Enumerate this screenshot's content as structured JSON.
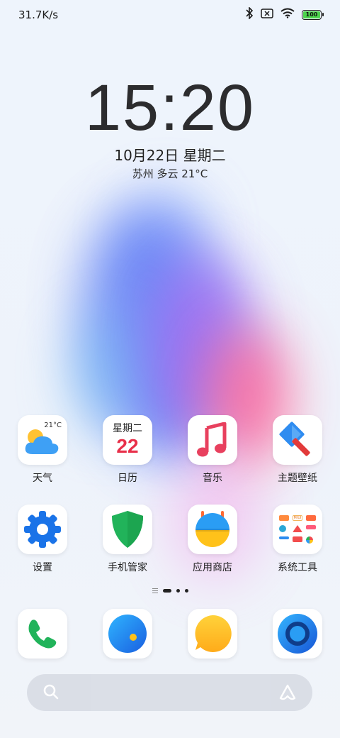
{
  "status_bar": {
    "network_speed": "31.7K/s",
    "battery_level": "100",
    "icons": [
      "bluetooth-icon",
      "no-sim-icon",
      "wifi-icon",
      "battery-icon"
    ]
  },
  "lockscreen_widget": {
    "time": "15:20",
    "date": "10月22日 星期二",
    "weather": "苏州 多云 21°C"
  },
  "home_apps": [
    {
      "label": "天气",
      "icon": "weather-icon",
      "temp": "21°C"
    },
    {
      "label": "日历",
      "icon": "calendar-icon",
      "weekday": "星期二",
      "day": "22"
    },
    {
      "label": "音乐",
      "icon": "music-icon"
    },
    {
      "label": "主题壁纸",
      "icon": "theme-brush-icon"
    },
    {
      "label": "设置",
      "icon": "settings-gear-icon"
    },
    {
      "label": "手机管家",
      "icon": "security-shield-icon"
    },
    {
      "label": "应用商店",
      "icon": "app-store-icon"
    },
    {
      "label": "系统工具",
      "icon": "system-tools-folder-icon",
      "folder_badge": "MIUI"
    }
  ],
  "page_indicator": {
    "pages": 4,
    "active": 1
  },
  "dock": [
    {
      "icon": "phone-icon"
    },
    {
      "icon": "messages-icon"
    },
    {
      "icon": "chat-bubble-icon"
    },
    {
      "icon": "browser-icon"
    }
  ],
  "search_bar": {
    "left_icon": "search-icon",
    "right_icon": "assistant-icon"
  },
  "colors": {
    "calendar_red": "#e8304a",
    "battery_green": "#4cd44c",
    "settings_blue": "#1a73e8",
    "security_green": "#21b35a",
    "music_pink": "#e8405e"
  }
}
